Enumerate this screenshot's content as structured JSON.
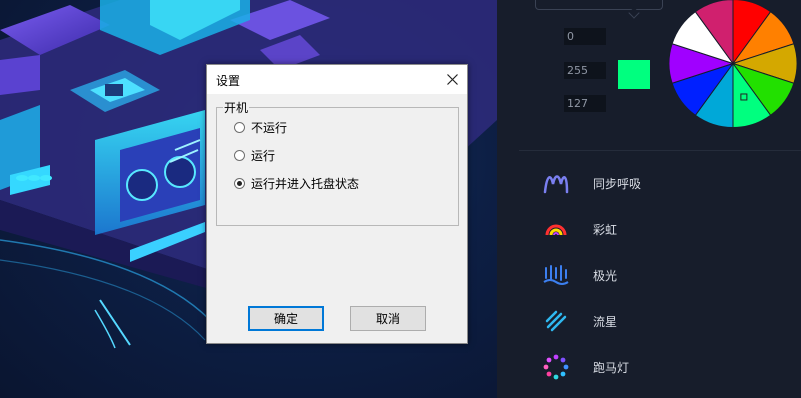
{
  "dialog": {
    "title": "设置",
    "group_label": "开机",
    "options": [
      {
        "label": "不运行",
        "checked": false
      },
      {
        "label": "运行",
        "checked": false
      },
      {
        "label": "运行并进入托盘状态",
        "checked": true
      }
    ],
    "ok_label": "确定",
    "cancel_label": "取消"
  },
  "color_picker": {
    "r": "0",
    "g": "255",
    "b": "127",
    "selected_color": "#00ff7f",
    "wheel_colors": [
      "#ff0000",
      "#ff8000",
      "#d4a800",
      "#22e000",
      "#00ff7f",
      "#00a8d8",
      "#0020ff",
      "#a000ff",
      "#ffffff",
      "#d0206e"
    ]
  },
  "effects": [
    {
      "label": "同步呼吸",
      "icon": "breathing-wave-icon"
    },
    {
      "label": "彩虹",
      "icon": "rainbow-arc-icon"
    },
    {
      "label": "极光",
      "icon": "aurora-icon"
    },
    {
      "label": "流星",
      "icon": "meteor-icon"
    },
    {
      "label": "跑马灯",
      "icon": "marquee-ring-icon"
    }
  ]
}
